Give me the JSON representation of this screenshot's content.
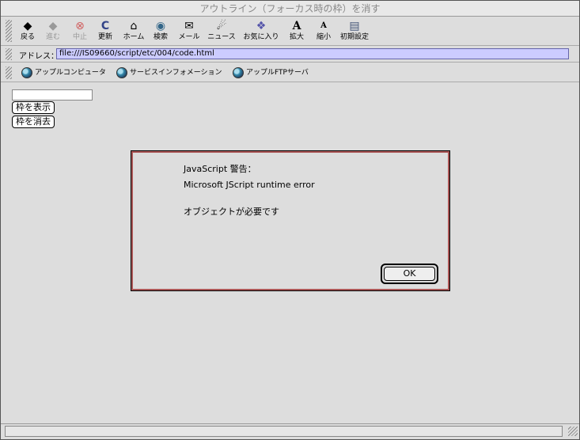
{
  "window": {
    "title": "アウトライン（フォーカス時の枠）を消す"
  },
  "toolbar": {
    "buttons": [
      {
        "label": "戻る",
        "icon": "back-arrow-icon",
        "glyph": "◆"
      },
      {
        "label": "進む",
        "icon": "forward-arrow-icon",
        "glyph": "◆"
      },
      {
        "label": "中止",
        "icon": "stop-icon",
        "glyph": "⊗"
      },
      {
        "label": "更新",
        "icon": "refresh-icon",
        "glyph": "C"
      },
      {
        "label": "ホーム",
        "icon": "home-icon",
        "glyph": "⌂"
      },
      {
        "label": "検索",
        "icon": "search-globe-icon",
        "glyph": "◉"
      },
      {
        "label": "メール",
        "icon": "mail-icon",
        "glyph": "✉"
      },
      {
        "label": "ニュース",
        "icon": "news-icon",
        "glyph": "☄"
      },
      {
        "label": "お気に入り",
        "icon": "favorites-folder-icon",
        "glyph": "❖"
      },
      {
        "label": "拡大",
        "icon": "text-larger-icon",
        "glyph": "A"
      },
      {
        "label": "縮小",
        "icon": "text-smaller-icon",
        "glyph": "A"
      },
      {
        "label": "初期設定",
        "icon": "preferences-icon",
        "glyph": "▤"
      }
    ]
  },
  "address": {
    "label": "アドレス：",
    "url": "file:///IS09660/script/etc/004/code.html"
  },
  "favorites": [
    {
      "label": "アップルコンピュータ"
    },
    {
      "label": "サービスインフォメーション"
    },
    {
      "label": "アップルFTPサーバ"
    }
  ],
  "page": {
    "show_button": "枠を表示",
    "hide_button": "枠を消去"
  },
  "dialog": {
    "title": "JavaScript 警告：",
    "error": "Microsoft JScript runtime error",
    "message": "オブジェクトが必要です",
    "ok_label": "OK"
  },
  "colors": {
    "address_bg": "#ccccff",
    "dialog_border": "#aa5555",
    "chrome": "#dddddd"
  }
}
